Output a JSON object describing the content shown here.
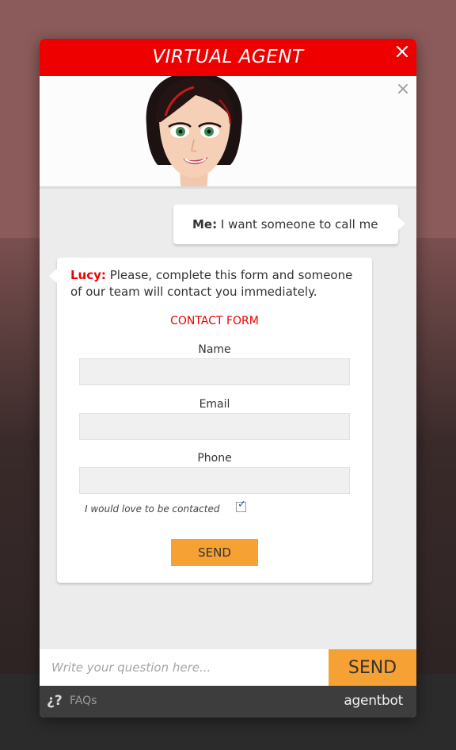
{
  "widget": {
    "title": "VIRTUAL AGENT",
    "accent_color": "#ee0000",
    "button_color": "#f6a133"
  },
  "chat": {
    "user_message": {
      "speaker": "Me:",
      "text": "I want someone to call me"
    },
    "bot_message": {
      "speaker": "Lucy:",
      "text": "Please, complete this form and someone of our team will contact you immediately."
    }
  },
  "form": {
    "title": "CONTACT FORM",
    "fields": [
      {
        "label": "Name",
        "value": ""
      },
      {
        "label": "Email",
        "value": ""
      },
      {
        "label": "Phone",
        "value": ""
      }
    ],
    "consent_label": "I would love to be contacted",
    "consent_checked": true,
    "submit_label": "SEND"
  },
  "input": {
    "placeholder": "Write your question here...",
    "send_label": "SEND"
  },
  "footer": {
    "faq_icon": "¿?",
    "faq_label": "FAQs",
    "logo": "agentbot"
  },
  "icons": {
    "title_close": "close-icon",
    "avatar_close": "close-icon",
    "faq": "question-icon"
  }
}
